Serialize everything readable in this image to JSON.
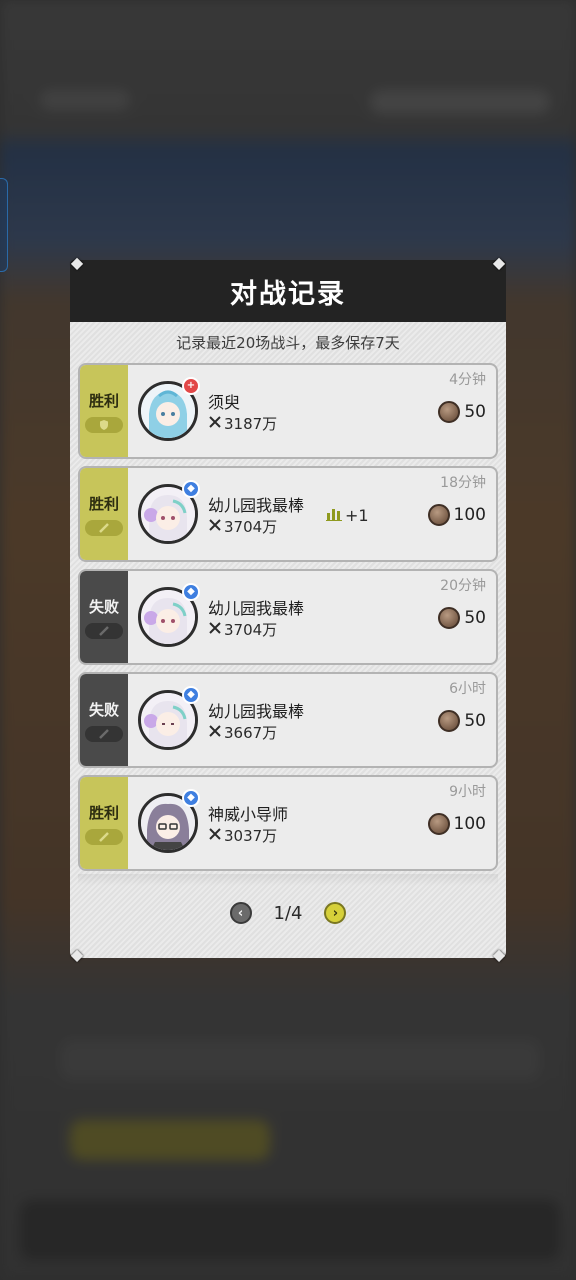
{
  "dialog": {
    "title": "对战记录",
    "subtitle": "记录最近20场战斗，最多保存7天"
  },
  "records": [
    {
      "result": "胜利",
      "name": "须臾",
      "power": "3187万",
      "time": "4分钟",
      "reward": "50",
      "badge": "red",
      "rank_change": ""
    },
    {
      "result": "胜利",
      "name": "幼儿园我最棒",
      "power": "3704万",
      "time": "18分钟",
      "reward": "100",
      "badge": "blue",
      "rank_change": "+1"
    },
    {
      "result": "失败",
      "name": "幼儿园我最棒",
      "power": "3704万",
      "time": "20分钟",
      "reward": "50",
      "badge": "blue",
      "rank_change": ""
    },
    {
      "result": "失败",
      "name": "幼儿园我最棒",
      "power": "3667万",
      "time": "6小时",
      "reward": "50",
      "badge": "blue",
      "rank_change": ""
    },
    {
      "result": "胜利",
      "name": "神威小导师",
      "power": "3037万",
      "time": "9小时",
      "reward": "100",
      "badge": "blue",
      "rank_change": ""
    }
  ],
  "pager": {
    "page": "1/4"
  },
  "colors": {
    "win": "#c7c55a",
    "lose": "#4a4a4a",
    "header": "#232323",
    "panel": "#e4e4e4"
  },
  "icons": {
    "power": "crossed-swords-icon",
    "reward": "coin-icon",
    "rank": "bar-chart-icon",
    "prev": "chevron-left-icon",
    "next": "chevron-right-icon"
  }
}
